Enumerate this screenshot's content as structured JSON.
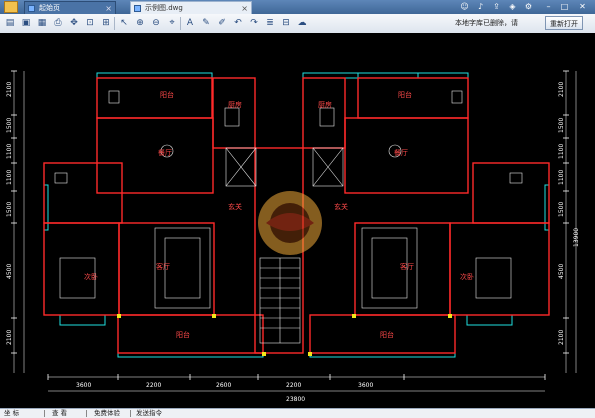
{
  "titlebar": {
    "tabs": [
      {
        "label": "起始页"
      },
      {
        "label": "示例图.dwg"
      }
    ],
    "buttons": [
      "user-icon",
      "bell-icon",
      "share-icon",
      "skin-icon",
      "settings-icon",
      "minimize-icon",
      "maximize-icon",
      "close-icon"
    ]
  },
  "toolbar": {
    "message": "本地字库已删除，请",
    "reopen_label": "重新打开"
  },
  "drawing": {
    "rooms": {
      "balcony_top_left": "阳台",
      "kitchen_left": "厨房",
      "dining_left": "餐厅",
      "foyer_left": "玄关",
      "bedroom_left": "次卧",
      "living_left": "客厅",
      "balcony_bottom_left": "阳台",
      "kitchen_right": "厨房",
      "balcony_top_right": "阳台",
      "dining_right": "餐厅",
      "foyer_right": "玄关",
      "living_right": "客厅",
      "bedroom_right": "次卧",
      "balcony_bottom_right": "阳台"
    },
    "dims_bottom": [
      "3600",
      "2200",
      "2600",
      "2200",
      "3600"
    ],
    "dim_total": "23800",
    "dims_left": [
      "2100",
      "1500",
      "1100",
      "1100",
      "1500",
      "4500",
      "2100"
    ],
    "dims_right": [
      "2100",
      "1500",
      "1100",
      "1100",
      "1500",
      "4500",
      "2100"
    ],
    "dim_right_total": "13900"
  },
  "statusbar": {
    "items": [
      "坐 标",
      "查 看",
      "免费体验",
      "发送指令"
    ]
  }
}
